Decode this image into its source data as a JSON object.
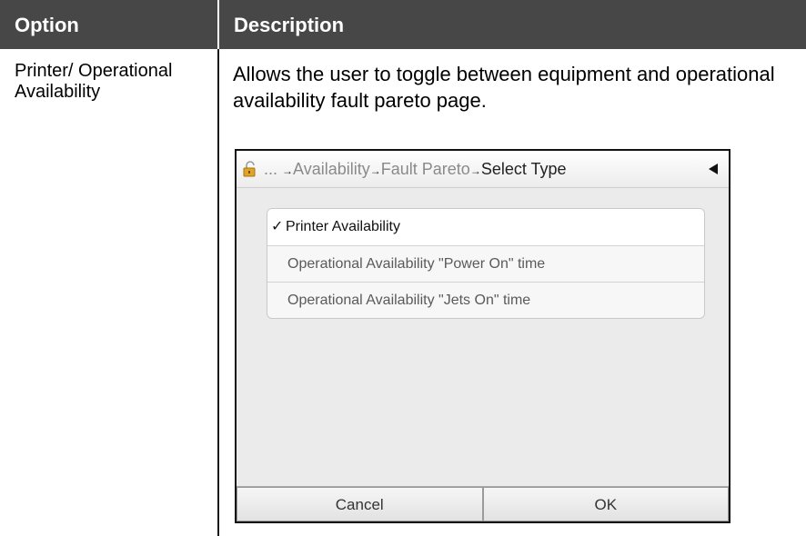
{
  "table": {
    "header": {
      "option": "Option",
      "description": "Description"
    },
    "row": {
      "option": "Printer/ Operational Availability",
      "description": "Allows the user to toggle between equipment and operational availability fault pareto page."
    }
  },
  "screen": {
    "breadcrumb": {
      "ellipsis": "...",
      "items": [
        "Availability",
        "Fault Pareto"
      ],
      "current": "Select Type",
      "separator": "→"
    },
    "icons": {
      "lock": "lock-icon",
      "back": "back-triangle-icon",
      "check": "check-icon"
    },
    "options": [
      {
        "label": "Printer Availability",
        "selected": true,
        "check": "✓"
      },
      {
        "label": "Operational Availability \"Power On\" time",
        "selected": false
      },
      {
        "label": "Operational Availability \"Jets On\" time",
        "selected": false
      }
    ],
    "buttons": {
      "cancel": "Cancel",
      "ok": "OK"
    }
  },
  "colors": {
    "header_bg": "#474747",
    "lock": "#e0a528"
  }
}
